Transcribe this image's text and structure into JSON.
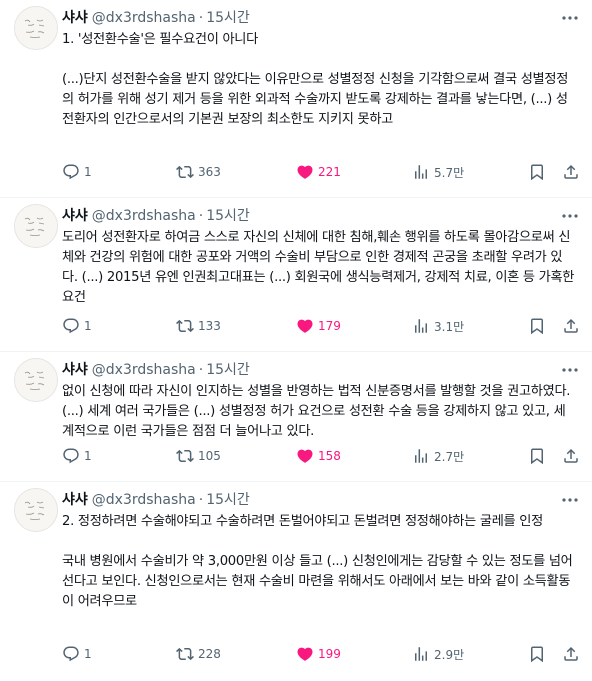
{
  "accent_color": "#1d9bf0",
  "like_color": "#f91880",
  "icons": {
    "reply": "reply-icon",
    "retweet": "retweet-icon",
    "like": "heart-filled-icon",
    "views": "views-bar-chart-icon",
    "bookmark": "bookmark-icon",
    "share": "share-icon",
    "more": "more-dots-icon"
  },
  "tweets": [
    {
      "author": "샤샤",
      "handle": "@dx3rdshasha",
      "time": "15시간",
      "text": "1. '성전환수술'은 필수요건이 아니다\n\n(...)단지 성전환수술을 받지 않았다는 이유만으로 성별정정 신청을 기각함으로써 결국 성별정정의 허가를 위해 성기 제거 등을 위한 외과적 수술까지 받도록 강제하는 결과를 낳는다면, (...) 성전환자의 인간으로서의 기본권 보장의 최소한도 지키지 못하고",
      "replies": "1",
      "retweets": "363",
      "likes": "221",
      "views": "5.7만"
    },
    {
      "author": "샤샤",
      "handle": "@dx3rdshasha",
      "time": "15시간",
      "text": "도리어 성전환자로 하여금 스스로 자신의 신체에 대한 침해,훼손 행위를 하도록 몰아감으로써 신체와 건강의 위험에 대한 공포와 거액의 수술비 부담으로 인한 경제적 곤궁을 초래할 우려가 있다. (...) 2015년 유엔 인권최고대표는 (...) 회원국에 생식능력제거, 강제적 치료, 이혼 등 가혹한 요건",
      "replies": "1",
      "retweets": "133",
      "likes": "179",
      "views": "3.1만"
    },
    {
      "author": "샤샤",
      "handle": "@dx3rdshasha",
      "time": "15시간",
      "text": "없이 신청에 따라 자신이 인지하는 성별을 반영하는 법적 신분증명서를 발행할 것을 권고하였다. (...) 세계 여러 국가들은 (...) 성별정정 허가 요건으로 성전환 수술 등을 강제하지 않고 있고, 세계적으로 이런 국가들은 점점 더 늘어나고 있다.",
      "replies": "1",
      "retweets": "105",
      "likes": "158",
      "views": "2.7만"
    },
    {
      "author": "샤샤",
      "handle": "@dx3rdshasha",
      "time": "15시간",
      "text": "2. 정정하려면 수술해야되고 수술하려면 돈벌어야되고 돈벌려면 정정해야하는 굴레를 인정\n\n국내 병원에서 수술비가 약 3,000만원 이상 들고 (...) 신청인에게는 감당할 수 있는 정도를 넘어선다고 보인다. 신청인으로서는 현재 수술비 마련을 위해서도 아래에서 보는 바와 같이 소득활동이 어려우므로",
      "replies": "1",
      "retweets": "228",
      "likes": "199",
      "views": "2.9만"
    }
  ]
}
